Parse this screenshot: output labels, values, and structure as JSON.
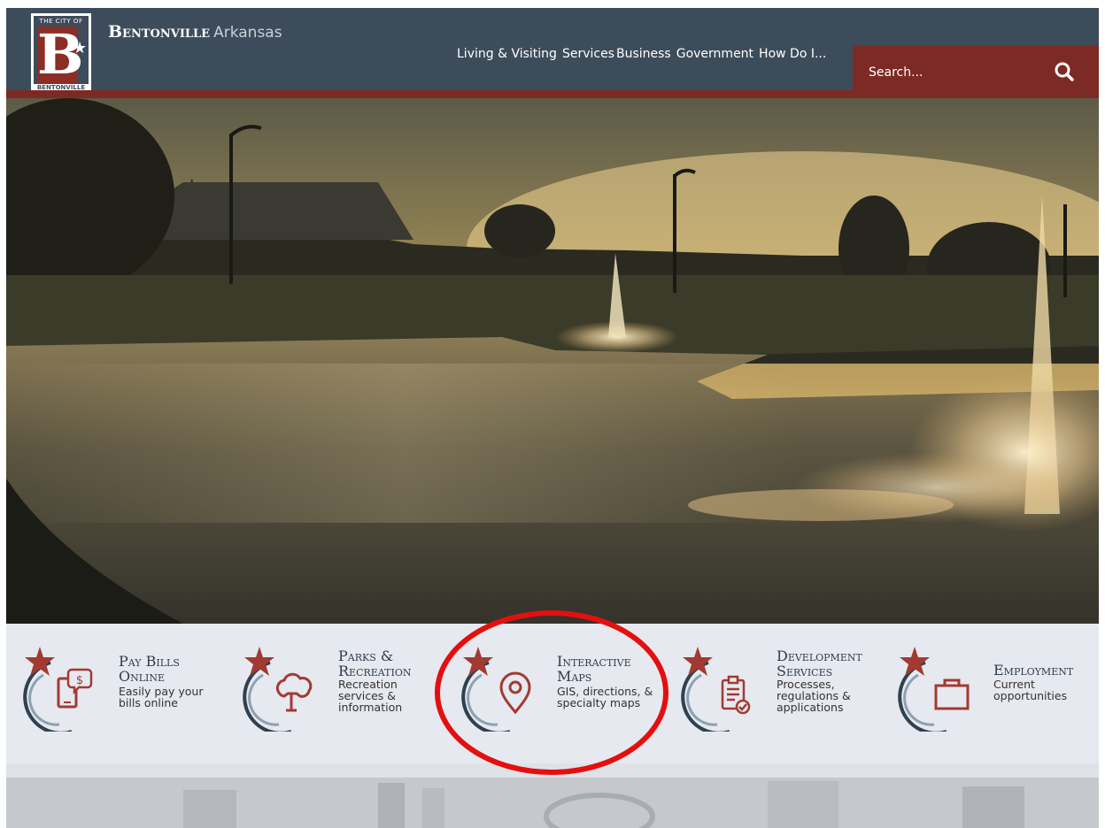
{
  "header": {
    "logo_top": "THE CITY OF",
    "logo_letter": "B",
    "logo_bottom": "BENTONVILLE",
    "brand_city": "Bentonville",
    "brand_state": "Arkansas",
    "nav": [
      "Living & Visiting",
      "Services",
      "Business",
      "Government",
      "How Do I..."
    ],
    "search_placeholder": "Search..."
  },
  "quick_links": [
    {
      "title_1": "Pay Bills",
      "title_2": "Online",
      "desc_1": "Easily pay your",
      "desc_2": "bills online",
      "desc_3": "",
      "icon": "bill-pay-phone-icon"
    },
    {
      "title_1": "Parks &",
      "title_2": "Recreation",
      "desc_1": "Recreation",
      "desc_2": "services &",
      "desc_3": "information",
      "icon": "tree-icon"
    },
    {
      "title_1": "Interactive",
      "title_2": "Maps",
      "desc_1": "GIS, directions, &",
      "desc_2": "specialty maps",
      "desc_3": "",
      "icon": "map-pin-icon"
    },
    {
      "title_1": "Development",
      "title_2": "Services",
      "desc_1": "Processes,",
      "desc_2": "regulations &",
      "desc_3": "applications",
      "icon": "clipboard-check-icon"
    },
    {
      "title_1": "Employment",
      "title_2": "",
      "desc_1": "Current",
      "desc_2": "opportunities",
      "desc_3": "",
      "icon": "briefcase-icon"
    }
  ],
  "colors": {
    "header": "#3d4c5a",
    "accent": "#7e2a24",
    "highlight_circle": "#e3100f"
  }
}
